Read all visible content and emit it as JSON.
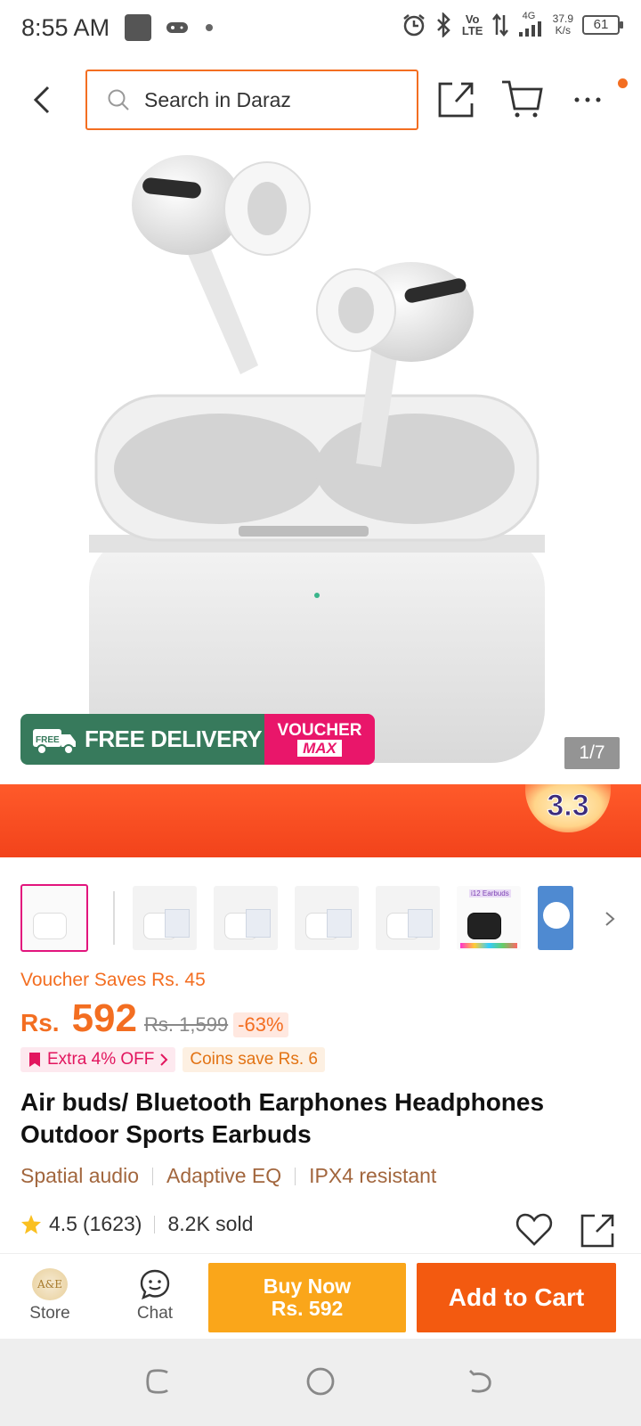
{
  "status_bar": {
    "time": "8:55 AM",
    "net_speed_value": "37.9",
    "net_speed_unit": "K/s",
    "battery": "61",
    "icons": [
      "app-square-icon",
      "game-controller-icon",
      "dot-icon",
      "alarm-icon",
      "bluetooth-icon",
      "volte-icon",
      "data-arrows-icon",
      "4g-signal-icon"
    ],
    "volte_label": "Vo LTE",
    "network_label": "4G"
  },
  "top_nav": {
    "search_placeholder": "Search in Daraz",
    "accent_color": "#f36e21"
  },
  "hero": {
    "free_delivery_small": "FREE",
    "free_delivery": "FREE DELIVERY",
    "voucher_top": "VOUCHER",
    "voucher_bottom": "MAX",
    "counter": "1/7"
  },
  "promo": {
    "label": "3.3"
  },
  "thumbnails": {
    "count": 8,
    "thumb2_label": "i12 Earbuds"
  },
  "pricing": {
    "voucher_saves": "Voucher Saves Rs. 45",
    "currency": "Rs.",
    "price": "592",
    "original_price": "Rs. 1,599",
    "discount": "-63%",
    "extra_off": "Extra 4% OFF",
    "coins_save": "Coins save Rs. 6"
  },
  "product": {
    "title": "Air buds/ Bluetooth Earphones Headphones Outdoor Sports Earbuds",
    "features": [
      "Spatial audio",
      "Adaptive EQ",
      "IPX4 resistant"
    ]
  },
  "rating": {
    "score": "4.5",
    "count": "(1623)",
    "sold": "8.2K sold"
  },
  "bottom_bar": {
    "store_label": "Store",
    "store_logo_text": "A&E",
    "chat_label": "Chat",
    "buy_now_line1": "Buy Now",
    "buy_now_line2": "Rs. 592",
    "add_to_cart": "Add to Cart",
    "buy_color": "#faa61a",
    "cart_color": "#f35a10"
  }
}
